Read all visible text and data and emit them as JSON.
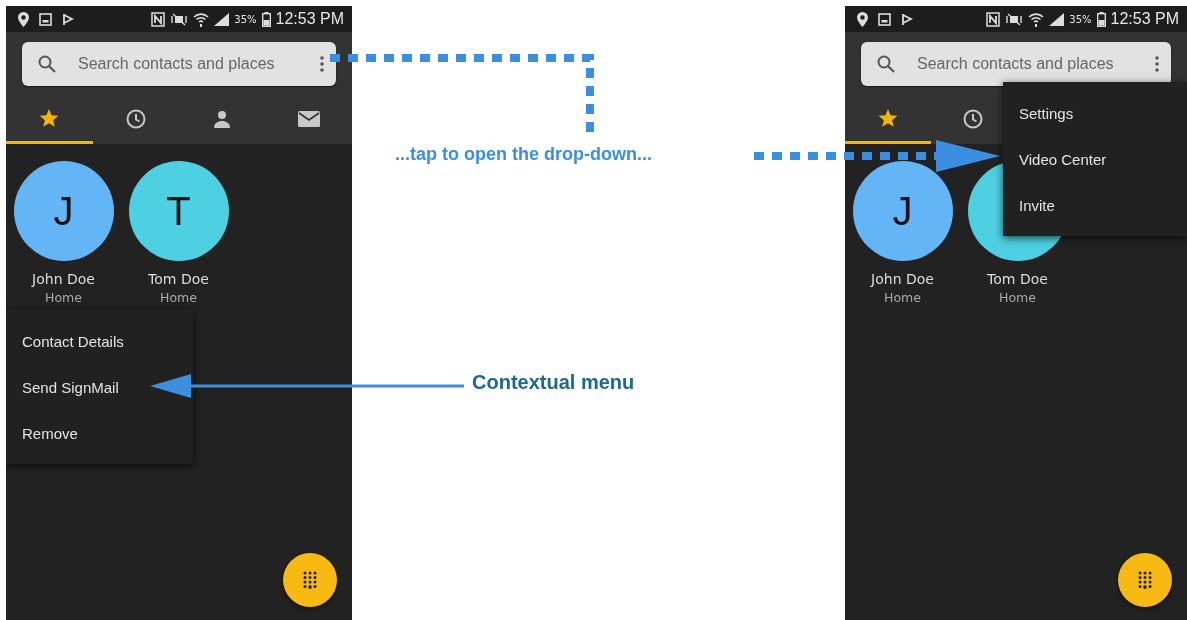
{
  "phones": [
    {
      "status_bar": {
        "battery": "35%",
        "time": "12:53 PM"
      },
      "search": {
        "placeholder": "Search contacts and places"
      },
      "tabs": [
        {
          "kind": "favorites",
          "selected": true
        },
        {
          "kind": "recents",
          "selected": false
        },
        {
          "kind": "contacts",
          "selected": false
        },
        {
          "kind": "messages",
          "selected": false
        }
      ],
      "contacts": [
        {
          "initial": "J",
          "name": "John Doe",
          "label": "Home",
          "color": "#64b5f6"
        },
        {
          "initial": "T",
          "name": "Tom Doe",
          "label": "Home",
          "color": "#4dd0e1"
        }
      ],
      "menu": {
        "kind": "context",
        "items": [
          "Contact Details",
          "Send SignMail",
          "Remove"
        ]
      }
    },
    {
      "status_bar": {
        "battery": "35%",
        "time": "12:53 PM"
      },
      "search": {
        "placeholder": "Search contacts and places"
      },
      "tabs": [
        {
          "kind": "favorites",
          "selected": true
        },
        {
          "kind": "recents",
          "selected": false
        }
      ],
      "contacts": [
        {
          "initial": "J",
          "name": "John Doe",
          "label": "Home",
          "color": "#64b5f6"
        },
        {
          "name": "Tom Doe",
          "label": "Home",
          "color": "#4dd0e1"
        }
      ],
      "menu": {
        "kind": "dropdown",
        "items": [
          "Settings",
          "Video Center",
          "Invite"
        ]
      }
    }
  ],
  "callouts": {
    "dropdown_hint": "...tap to open the drop-down...",
    "context_menu": "Contextual menu"
  }
}
